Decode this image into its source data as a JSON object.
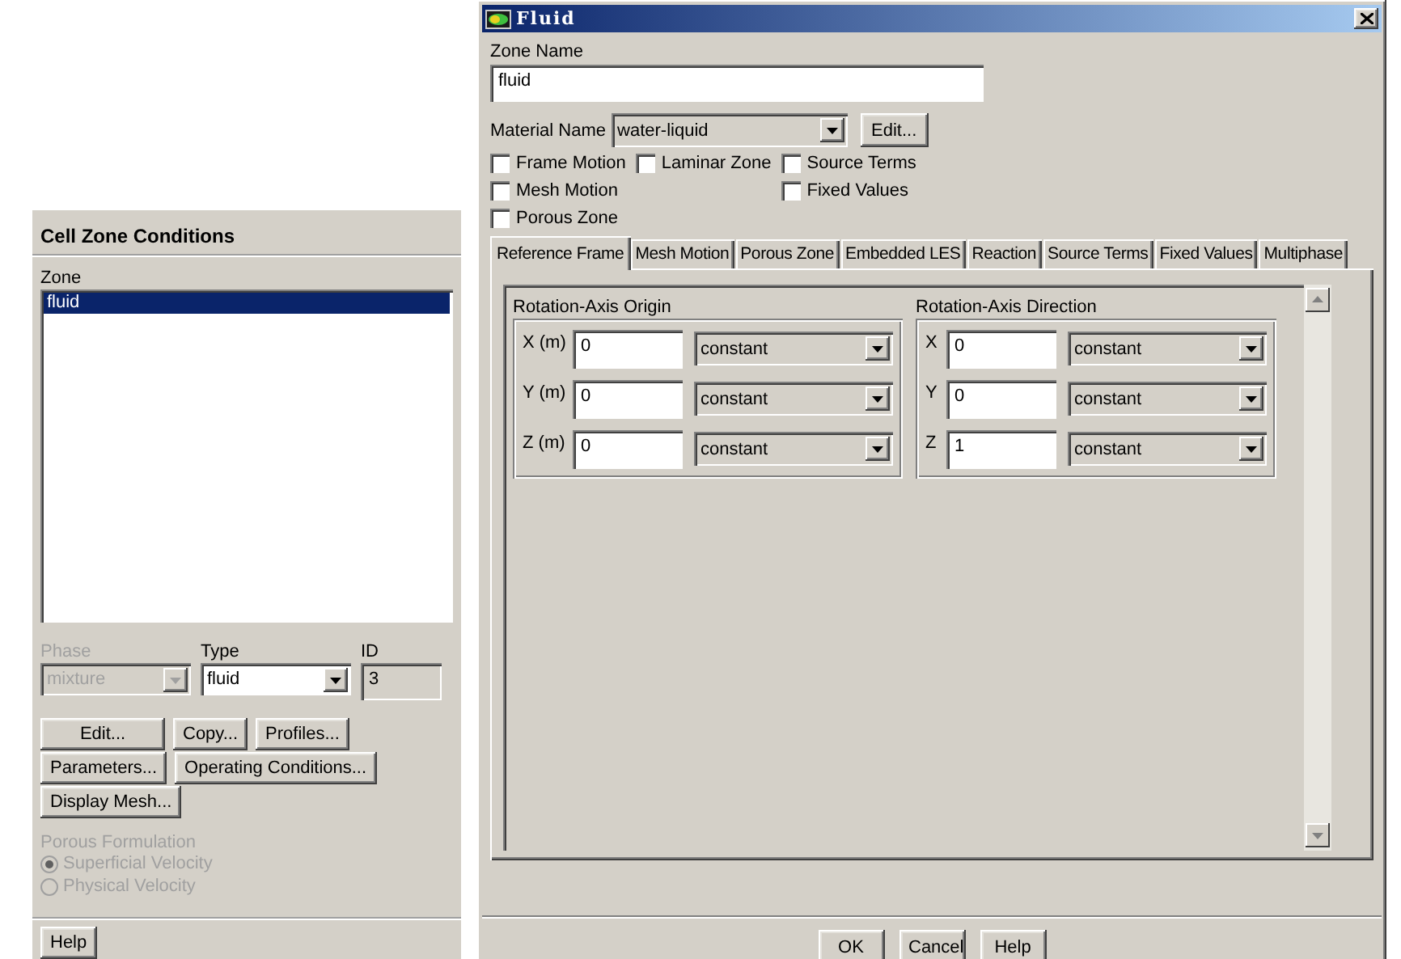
{
  "cell_zone_panel": {
    "title": "Cell Zone Conditions",
    "zone_label": "Zone",
    "zones": [
      {
        "label": "fluid",
        "selected": true
      }
    ],
    "phase": {
      "label": "Phase",
      "value": "mixture",
      "disabled": true
    },
    "type": {
      "label": "Type",
      "value": "fluid"
    },
    "id": {
      "label": "ID",
      "value": "3"
    },
    "button_rows": [
      [
        "Edit...",
        "Copy...",
        "Profiles..."
      ],
      [
        "Parameters...",
        "Operating Conditions..."
      ],
      [
        "Display Mesh..."
      ]
    ],
    "porous_formulation": {
      "label": "Porous Formulation",
      "disabled": true,
      "options": [
        {
          "label": "Superficial Velocity",
          "selected": true
        },
        {
          "label": "Physical Velocity",
          "selected": false
        }
      ]
    },
    "help_button": "Help"
  },
  "fluid_dialog": {
    "title": "Fluid",
    "zone_name": {
      "label": "Zone Name",
      "value": "fluid"
    },
    "material": {
      "label": "Material Name",
      "value": "water-liquid",
      "edit_button": "Edit..."
    },
    "checkbox_columns": [
      [
        {
          "label": "Frame Motion",
          "checked": false
        },
        {
          "label": "Mesh Motion",
          "checked": false
        },
        {
          "label": "Porous Zone",
          "checked": false
        }
      ],
      [
        {
          "label": "Laminar Zone",
          "checked": false
        }
      ],
      [
        {
          "label": "Source Terms",
          "checked": false
        },
        {
          "label": "Fixed Values",
          "checked": false
        }
      ]
    ],
    "tabs": [
      {
        "label": "Reference Frame",
        "selected": true
      },
      {
        "label": "Mesh Motion",
        "selected": false
      },
      {
        "label": "Porous Zone",
        "selected": false
      },
      {
        "label": "Embedded LES",
        "selected": false
      },
      {
        "label": "Reaction",
        "selected": false
      },
      {
        "label": "Source Terms",
        "selected": false
      },
      {
        "label": "Fixed Values",
        "selected": false
      },
      {
        "label": "Multiphase",
        "selected": false
      }
    ],
    "groups": [
      {
        "title": "Rotation-Axis Origin",
        "rows": [
          {
            "label": "X (m)",
            "value": "0",
            "method": "constant"
          },
          {
            "label": "Y (m)",
            "value": "0",
            "method": "constant"
          },
          {
            "label": "Z (m)",
            "value": "0",
            "method": "constant"
          }
        ]
      },
      {
        "title": "Rotation-Axis Direction",
        "rows": [
          {
            "label": "X",
            "value": "0",
            "method": "constant"
          },
          {
            "label": "Y",
            "value": "0",
            "method": "constant"
          },
          {
            "label": "Z",
            "value": "1",
            "method": "constant"
          }
        ]
      }
    ],
    "buttons": [
      "OK",
      "Cancel",
      "Help"
    ]
  }
}
